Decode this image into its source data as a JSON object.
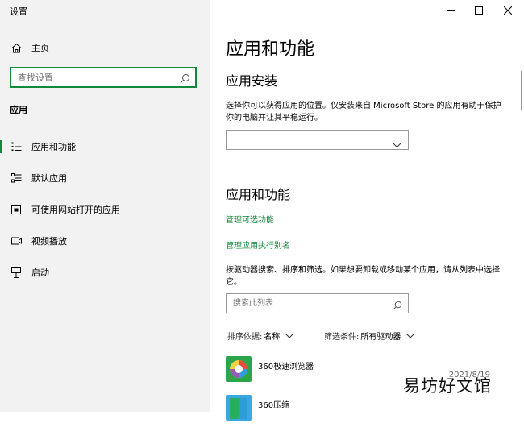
{
  "window": {
    "title": "设置",
    "controls": [
      "minimize",
      "maximize",
      "close"
    ]
  },
  "sidebar": {
    "home_label": "主页",
    "search_placeholder": "查找设置",
    "section_label": "应用",
    "items": [
      {
        "label": "应用和功能",
        "icon": "list-icon",
        "active": true
      },
      {
        "label": "默认应用",
        "icon": "default-apps-icon",
        "active": false
      },
      {
        "label": "可使用网站打开的应用",
        "icon": "website-app-icon",
        "active": false
      },
      {
        "label": "视频播放",
        "icon": "video-icon",
        "active": false
      },
      {
        "label": "启动",
        "icon": "startup-icon",
        "active": false
      }
    ]
  },
  "main": {
    "title": "应用和功能",
    "install_heading": "应用安装",
    "install_desc": "选择你可以获得应用的位置。仅安装来自 Microsoft Store 的应用有助于保护你的电脑并让其平稳运行。",
    "install_dropdown_value": "",
    "apps_heading": "应用和功能",
    "link_optional_features": "管理可选功能",
    "link_alias": "管理应用执行别名",
    "search_desc": "按驱动器搜索、排序和筛选。如果想要卸载或移动某个应用，请从列表中选择它。",
    "search_placeholder": "搜索此列表",
    "sort_label": "排序依据:",
    "sort_value": "名称",
    "filter_label": "筛选条件:",
    "filter_value": "所有驱动器",
    "apps": [
      {
        "name": "360极速浏览器",
        "date": "2021/8/19"
      },
      {
        "name": "360压缩",
        "date": ""
      }
    ]
  },
  "watermark": "易坊好文馆",
  "colors": {
    "accent": "#10893e",
    "sidebar_bg": "#f2f2f2"
  }
}
